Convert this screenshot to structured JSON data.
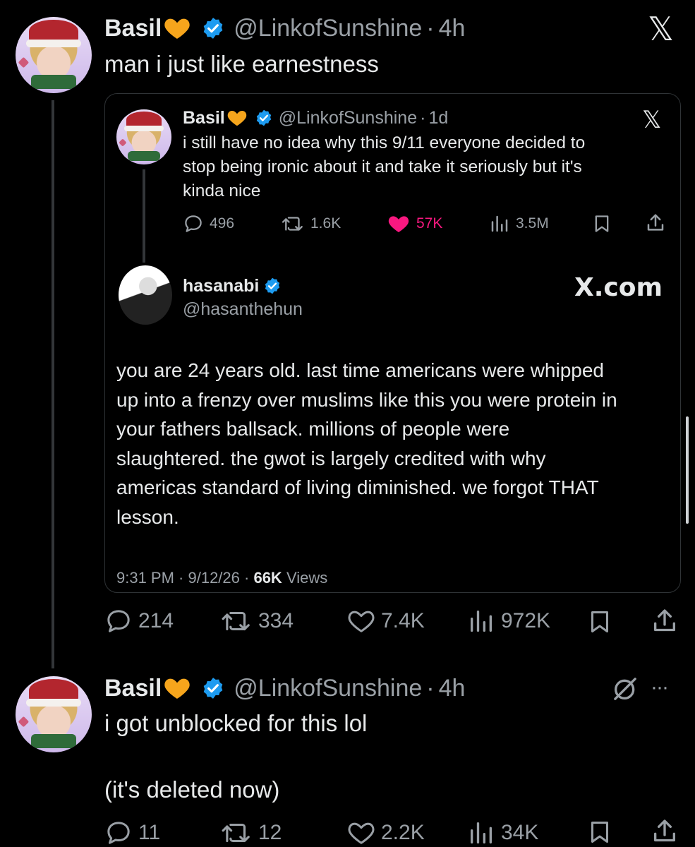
{
  "tweet1": {
    "name": "Basil",
    "handle": "@LinkofSunshine",
    "time": "4h",
    "text": "man i just like earnestness",
    "metrics": {
      "replies": "214",
      "retweets": "334",
      "likes": "7.4K",
      "views": "972K"
    }
  },
  "quoted": {
    "name": "Basil",
    "handle": "@LinkofSunshine",
    "time": "1d",
    "text_lines": [
      "i still have no idea why this 9/11 everyone decided to",
      "stop being ironic about it and take it seriously but it's",
      "kinda nice"
    ],
    "metrics": {
      "replies": "496",
      "retweets": "1.6K",
      "likes": "57K",
      "views": "3.5M"
    },
    "embedded": {
      "name": "hasanabi",
      "handle": "@hasanthehun",
      "source": "X.com",
      "text_lines": [
        "you are 24 years old. last time americans were whipped",
        "up into a frenzy over muslims like this you were protein in",
        "your fathers ballsack. millions of people were",
        "slaughtered. the gwot is largely credited with why",
        "americas standard of living diminished. we forgot THAT",
        "lesson."
      ],
      "footer_time": "9:31 PM · 9/12/26 ·",
      "footer_views_count": "66K",
      "footer_views_label": "Views"
    }
  },
  "tweet2": {
    "name": "Basil",
    "handle": "@LinkofSunshine",
    "time": "4h",
    "text_line1": "i got unblocked for this lol",
    "text_line2": "(it's deleted now)",
    "more": "···",
    "metrics": {
      "replies": "11",
      "retweets": "12",
      "likes": "2.2K",
      "views": "34K"
    }
  },
  "dot": "·",
  "icons": [
    "x-logo-icon",
    "verified-badge-icon",
    "orange-heart-icon",
    "reply-icon",
    "retweet-icon",
    "like-icon",
    "views-icon",
    "bookmark-icon",
    "share-icon",
    "grok-icon",
    "more-icon"
  ],
  "colors": {
    "background": "#000000",
    "text": "#e7e9ea",
    "muted": "#9aa0a6",
    "verified": "#1d9bf0",
    "like_active": "#f91880",
    "heart_emoji": "#f6a51c"
  }
}
